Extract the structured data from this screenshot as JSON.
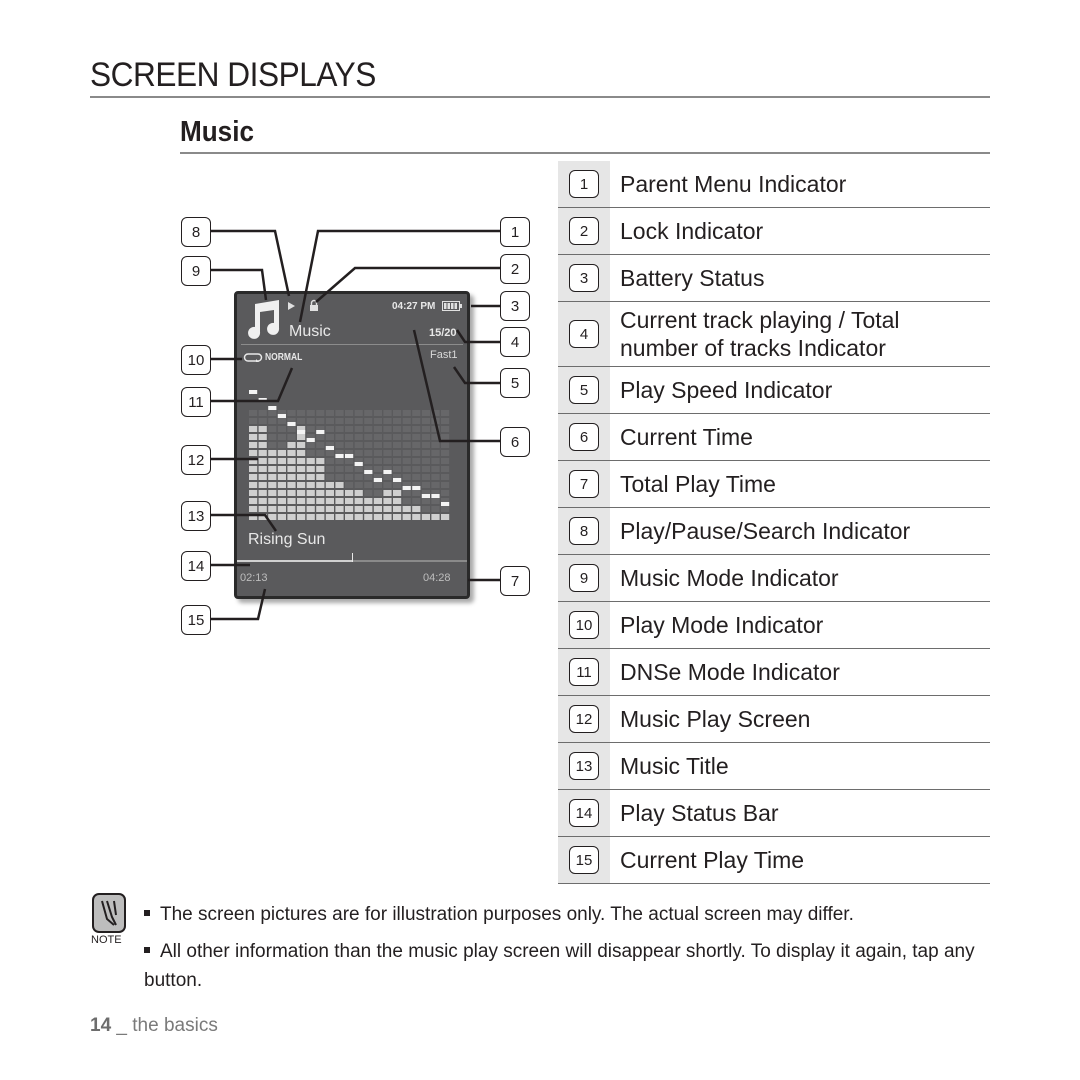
{
  "page_title": "SCREEN DISPLAYS",
  "section_title": "Music",
  "device_screen": {
    "menu_label": "Music",
    "time": "04:27 PM",
    "track_counter": "15/20",
    "play_mode": "NORMAL",
    "play_speed": "Fast1",
    "music_title": "Rising Sun",
    "current_play_time": "02:13",
    "total_play_time": "04:28",
    "progress_fraction": 0.5
  },
  "legend": [
    {
      "num": "1",
      "label": "Parent Menu Indicator"
    },
    {
      "num": "2",
      "label": "Lock Indicator"
    },
    {
      "num": "3",
      "label": "Battery Status"
    },
    {
      "num": "4",
      "label": "Current track playing / Total number of tracks Indicator"
    },
    {
      "num": "5",
      "label": "Play Speed Indicator"
    },
    {
      "num": "6",
      "label": "Current Time"
    },
    {
      "num": "7",
      "label": "Total Play Time"
    },
    {
      "num": "8",
      "label": "Play/Pause/Search Indicator"
    },
    {
      "num": "9",
      "label": "Music Mode Indicator"
    },
    {
      "num": "10",
      "label": "Play Mode Indicator"
    },
    {
      "num": "11",
      "label": "DNSe Mode Indicator"
    },
    {
      "num": "12",
      "label": "Music Play Screen"
    },
    {
      "num": "13",
      "label": "Music Title"
    },
    {
      "num": "14",
      "label": "Play Status Bar"
    },
    {
      "num": "15",
      "label": "Current Play Time"
    }
  ],
  "callouts": [
    "1",
    "2",
    "3",
    "4",
    "5",
    "6",
    "7",
    "8",
    "9",
    "10",
    "11",
    "12",
    "13",
    "14",
    "15"
  ],
  "note": {
    "label": "NOTE",
    "items": [
      "The screen pictures are for illustration purposes only. The actual screen may differ.",
      "All other information than the music play screen will disappear shortly. To display it again, tap any button."
    ]
  },
  "footer": {
    "page_number": "14",
    "separator": "_",
    "section": "the basics"
  }
}
